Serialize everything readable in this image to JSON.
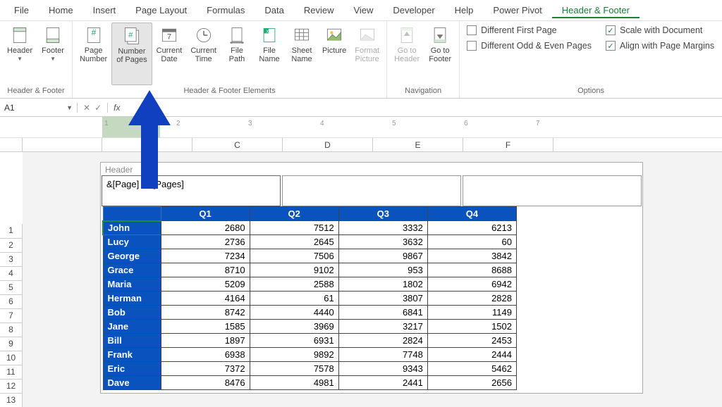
{
  "menus": [
    "File",
    "Home",
    "Insert",
    "Page Layout",
    "Formulas",
    "Data",
    "Review",
    "View",
    "Developer",
    "Help",
    "Power Pivot",
    "Header & Footer"
  ],
  "active_menu": "Header & Footer",
  "ribbon": {
    "group1": {
      "label": "Header & Footer",
      "buttons": [
        {
          "label": "Header",
          "dd": true
        },
        {
          "label": "Footer",
          "dd": true
        }
      ]
    },
    "group2": {
      "label": "Header & Footer Elements",
      "buttons": [
        {
          "label": "Page\nNumber"
        },
        {
          "label": "Number\nof Pages",
          "hl": true
        },
        {
          "label": "Current\nDate"
        },
        {
          "label": "Current\nTime"
        },
        {
          "label": "File\nPath"
        },
        {
          "label": "File\nName"
        },
        {
          "label": "Sheet\nName"
        },
        {
          "label": "Picture"
        },
        {
          "label": "Format\nPicture",
          "disabled": true
        }
      ]
    },
    "group3": {
      "label": "Navigation",
      "buttons": [
        {
          "label": "Go to\nHeader",
          "disabled": true
        },
        {
          "label": "Go to\nFooter"
        }
      ]
    },
    "group4": {
      "label": "Options",
      "left": [
        {
          "label": "Different First Page",
          "on": false
        },
        {
          "label": "Different Odd & Even Pages",
          "on": false
        }
      ],
      "right": [
        {
          "label": "Scale with Document",
          "on": true
        },
        {
          "label": "Align with Page Margins",
          "on": true
        }
      ]
    }
  },
  "name_box": "A1",
  "ruler_ticks": [
    1,
    2,
    3,
    4,
    5,
    6,
    7
  ],
  "columns": [
    "B",
    "C",
    "D",
    "E",
    "F"
  ],
  "header_label": "Header",
  "header_value": "&[Page] / &[Pages]",
  "chart_data": {
    "type": "table",
    "columns": [
      "",
      "Q1",
      "Q2",
      "Q3",
      "Q4"
    ],
    "rows": [
      [
        "John",
        2680,
        7512,
        3332,
        6213
      ],
      [
        "Lucy",
        2736,
        2645,
        3632,
        60
      ],
      [
        "George",
        7234,
        7506,
        9867,
        3842
      ],
      [
        "Grace",
        8710,
        9102,
        953,
        8688
      ],
      [
        "Maria",
        5209,
        2588,
        1802,
        6942
      ],
      [
        "Herman",
        4164,
        61,
        3807,
        2828
      ],
      [
        "Bob",
        8742,
        4440,
        6841,
        1149
      ],
      [
        "Jane",
        1585,
        3969,
        3217,
        1502
      ],
      [
        "Bill",
        1897,
        6931,
        2824,
        2453
      ],
      [
        "Frank",
        6938,
        9892,
        7748,
        2444
      ],
      [
        "Eric",
        7372,
        7578,
        9343,
        5462
      ],
      [
        "Dave",
        8476,
        4981,
        2441,
        2656
      ]
    ]
  },
  "row_numbers": [
    1,
    2,
    3,
    4,
    5,
    6,
    7,
    8,
    9,
    10,
    11,
    12,
    13
  ]
}
